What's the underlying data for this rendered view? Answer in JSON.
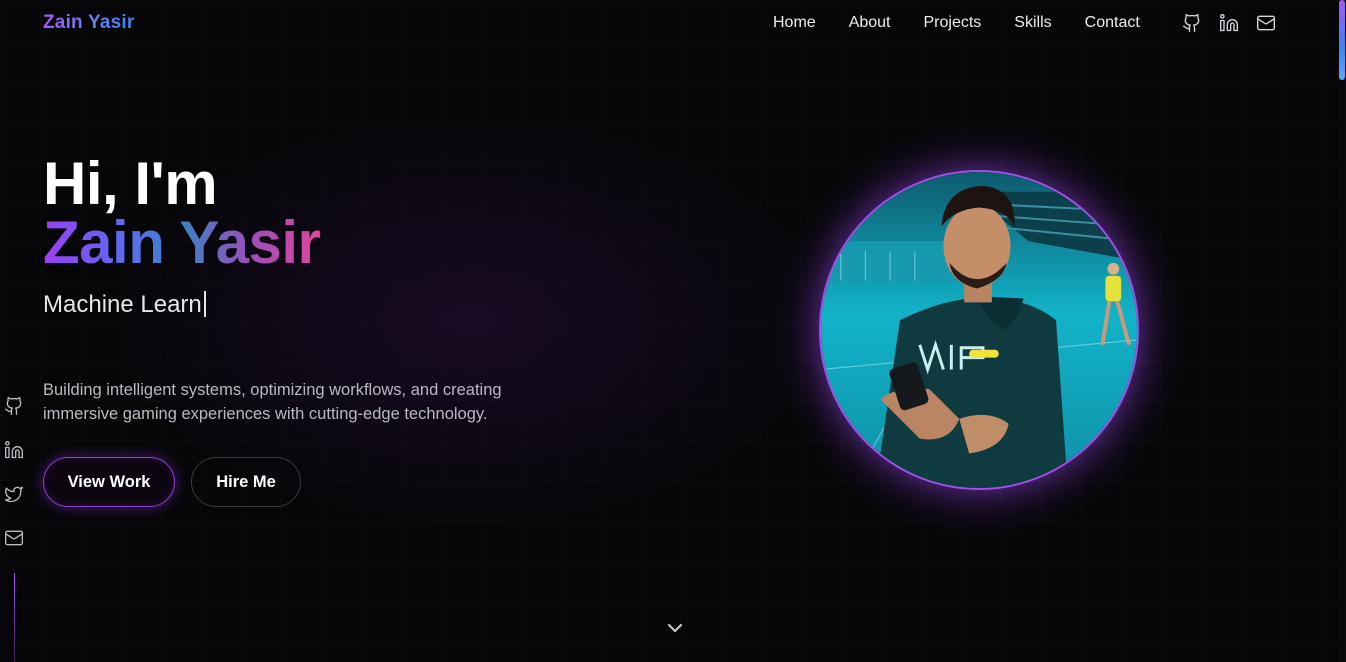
{
  "header": {
    "logo": "Zain Yasir",
    "nav": [
      {
        "label": "Home"
      },
      {
        "label": "About"
      },
      {
        "label": "Projects"
      },
      {
        "label": "Skills"
      },
      {
        "label": "Contact"
      }
    ],
    "icons": [
      "github-icon",
      "linkedin-icon",
      "mail-icon"
    ]
  },
  "side_rail": {
    "icons": [
      "github-icon",
      "linkedin-icon",
      "twitter-icon",
      "mail-icon"
    ]
  },
  "hero": {
    "greeting": "Hi, I'm",
    "name": "Zain Yasir",
    "typed_text": "Machine Learn",
    "tagline": "Building intelligent systems, optimizing workflows, and creating immersive gaming experiences with cutting-edge technology.",
    "primary_button": "View Work",
    "secondary_button": "Hire Me"
  },
  "portrait": {
    "alt": "profile-photo"
  },
  "colors": {
    "background": "#060608",
    "accent_purple": "#a855f7",
    "accent_blue": "#3b82f6",
    "accent_pink": "#e0459e"
  },
  "scroll_indicator": "chevron-down-icon"
}
